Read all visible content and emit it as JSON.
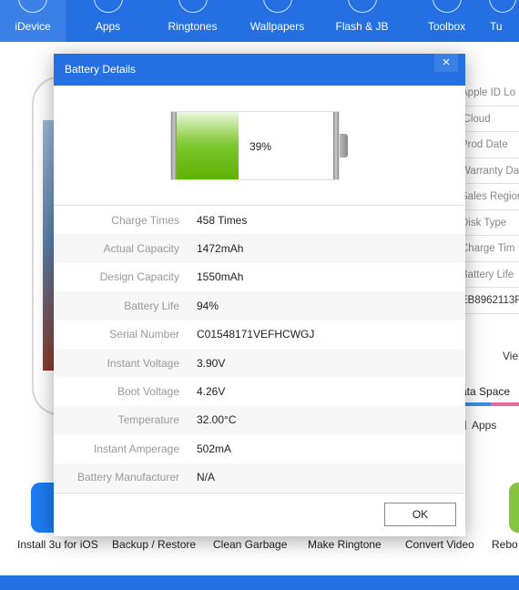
{
  "nav": {
    "items": [
      {
        "label": "iDevice"
      },
      {
        "label": "Apps"
      },
      {
        "label": "Ringtones"
      },
      {
        "label": "Wallpapers"
      },
      {
        "label": "Flash & JB"
      },
      {
        "label": "Toolbox"
      },
      {
        "label": "Tu"
      }
    ]
  },
  "right_panel": {
    "rows": [
      "Apple ID Lo",
      "iCloud",
      "Prod Date",
      "Warranty Da",
      "Sales Region",
      "Disk Type",
      "Charge Tim",
      "Battery Life",
      "EB8962113F"
    ],
    "view": "Vie",
    "data_space": "ata Space",
    "apps": "Apps"
  },
  "tools": [
    "Install 3u for iOS",
    "Backup / Restore",
    "Clean Garbage",
    "Make Ringtone",
    "Convert Video",
    "Rebo"
  ],
  "dialog": {
    "title": "Battery Details",
    "close": "×",
    "battery_percent": 39,
    "battery_label": "39%",
    "rows": [
      {
        "k": "Charge Times",
        "v": "458 Times"
      },
      {
        "k": "Actual Capacity",
        "v": "1472mAh"
      },
      {
        "k": "Design Capacity",
        "v": "1550mAh"
      },
      {
        "k": "Battery Life",
        "v": "94%"
      },
      {
        "k": "Serial Number",
        "v": "C01548171VEFHCWGJ"
      },
      {
        "k": "Instant Voltage",
        "v": "3.90V"
      },
      {
        "k": "Boot Voltage",
        "v": "4.26V"
      },
      {
        "k": "Temperature",
        "v": "32.00°C"
      },
      {
        "k": "Instant Amperage",
        "v": "502mA"
      },
      {
        "k": "Battery Manufacturer",
        "v": "N/A"
      }
    ],
    "ok": "OK"
  },
  "colors": {
    "brand": "#2470e2",
    "battery_green": "#7cc830"
  }
}
